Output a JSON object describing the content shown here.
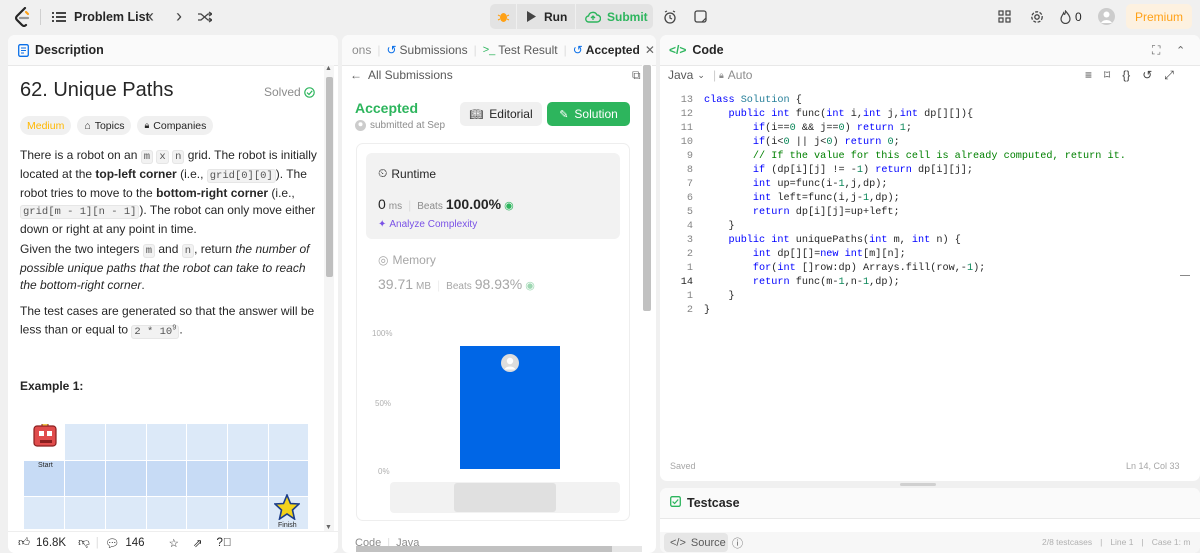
{
  "topbar": {
    "problem_list": "Problem List",
    "run": "Run",
    "submit": "Submit",
    "fire_count": "0",
    "premium": "Premium"
  },
  "desc": {
    "tab": "Description",
    "title": "62. Unique Paths",
    "solved": "Solved",
    "difficulty": "Medium",
    "topics": "Topics",
    "companies": "Companies",
    "p1": {
      "a": "There is a robot on an ",
      "m": "m",
      "x": "x",
      "n": "n",
      "b": " grid. The robot is initially located at the ",
      "tl": "top-left corner",
      "c": " (i.e., ",
      "g1": "grid[0][0]",
      "d": "). The robot tries to move to the ",
      "br": "bottom-right corner",
      "e": " (i.e., ",
      "g2": "grid[m - 1][n - 1]",
      "f": "). The robot can only move either down or right at any point in time."
    },
    "p2": {
      "a": "Given the two integers ",
      "m": "m",
      "and": " and ",
      "n": "n",
      ", return ": ", return ",
      "em": "the number of possible unique paths that the robot can take to reach the bottom-right corner",
      "dot": "."
    },
    "p3": {
      "a": "The test cases are generated so that the answer will be less than or equal to ",
      "code": "2 * 10",
      "sup": "9",
      "dot": "."
    },
    "example_title": "Example 1:",
    "start": "Start",
    "finish": "Finish",
    "likes": "16.8K",
    "comments": "146"
  },
  "sub": {
    "tabs": [
      "ons",
      "Submissions",
      "Test Result",
      "Accepted"
    ],
    "all": "All Submissions",
    "status": "Accepted",
    "submitted": "submitted at Sep",
    "editorial": "Editorial",
    "solution": "Solution",
    "runtime": "Runtime",
    "rt_val": "0",
    "rt_unit": "ms",
    "beats": "Beats",
    "rt_pct": "100.00%",
    "analyze": "Analyze Complexity",
    "memory": "Memory",
    "mem_val": "39.71",
    "mem_unit": "MB",
    "mem_pct": "98.93%",
    "y100": "100%",
    "y50": "50%",
    "y0": "0%",
    "code_label": "Code",
    "lang_label": "Java",
    "bar_fraction": 1.0
  },
  "code": {
    "tab": "Code",
    "lang": "Java",
    "mode": "Auto",
    "lines": [
      {
        "n": "13",
        "c": [
          [
            "kw",
            "class "
          ],
          [
            "ty",
            "Solution"
          ],
          [
            "tx",
            " {"
          ]
        ]
      },
      {
        "n": "12",
        "c": [
          [
            "tx",
            "    "
          ],
          [
            "kw",
            "public int "
          ],
          [
            "tx",
            "func("
          ],
          [
            "kw",
            "int "
          ],
          [
            "tx",
            "i,"
          ],
          [
            "kw",
            "int "
          ],
          [
            "tx",
            "j,"
          ],
          [
            "kw",
            "int "
          ],
          [
            "tx",
            "dp[][]){"
          ]
        ]
      },
      {
        "n": "11",
        "c": [
          [
            "tx",
            "        "
          ],
          [
            "kw",
            "if"
          ],
          [
            "tx",
            "(i=="
          ],
          [
            "nm",
            "0"
          ],
          [
            "tx",
            " && j=="
          ],
          [
            "nm",
            "0"
          ],
          [
            "tx",
            ") "
          ],
          [
            "kw",
            "return "
          ],
          [
            "nm",
            "1"
          ],
          [
            "tx",
            ";"
          ]
        ]
      },
      {
        "n": "10",
        "c": [
          [
            "tx",
            "        "
          ],
          [
            "kw",
            "if"
          ],
          [
            "tx",
            "(i<"
          ],
          [
            "nm",
            "0"
          ],
          [
            "tx",
            " || j<"
          ],
          [
            "nm",
            "0"
          ],
          [
            "tx",
            ") "
          ],
          [
            "kw",
            "return "
          ],
          [
            "nm",
            "0"
          ],
          [
            "tx",
            ";"
          ]
        ]
      },
      {
        "n": "9",
        "c": [
          [
            "tx",
            "        "
          ],
          [
            "cm",
            "// If the value for this cell is already computed, return it."
          ]
        ]
      },
      {
        "n": "8",
        "c": [
          [
            "tx",
            "        "
          ],
          [
            "kw",
            "if"
          ],
          [
            "tx",
            " (dp[i][j] != -"
          ],
          [
            "nm",
            "1"
          ],
          [
            "tx",
            ") "
          ],
          [
            "kw",
            "return "
          ],
          [
            "tx",
            "dp[i][j];"
          ]
        ]
      },
      {
        "n": "7",
        "c": [
          [
            "tx",
            "        "
          ],
          [
            "kw",
            "int "
          ],
          [
            "tx",
            "up=func(i-"
          ],
          [
            "nm",
            "1"
          ],
          [
            "tx",
            ",j,dp);"
          ]
        ]
      },
      {
        "n": "6",
        "c": [
          [
            "tx",
            "        "
          ],
          [
            "kw",
            "int "
          ],
          [
            "tx",
            "left=func(i,j-"
          ],
          [
            "nm",
            "1"
          ],
          [
            "tx",
            ",dp);"
          ]
        ]
      },
      {
        "n": "5",
        "c": [
          [
            "tx",
            "        "
          ],
          [
            "kw",
            "return "
          ],
          [
            "tx",
            "dp[i][j]=up+left;"
          ]
        ]
      },
      {
        "n": "4",
        "c": [
          [
            "tx",
            "    }"
          ]
        ]
      },
      {
        "n": "3",
        "c": [
          [
            "tx",
            "    "
          ],
          [
            "kw",
            "public int "
          ],
          [
            "tx",
            "uniquePaths("
          ],
          [
            "kw",
            "int "
          ],
          [
            "tx",
            "m, "
          ],
          [
            "kw",
            "int "
          ],
          [
            "tx",
            "n) {"
          ]
        ]
      },
      {
        "n": "2",
        "c": [
          [
            "tx",
            "        "
          ],
          [
            "kw",
            "int "
          ],
          [
            "tx",
            "dp[][]="
          ],
          [
            "kw",
            "new int"
          ],
          [
            "tx",
            "[m][n];"
          ]
        ]
      },
      {
        "n": "1",
        "c": [
          [
            "tx",
            "        "
          ],
          [
            "kw",
            "for"
          ],
          [
            "tx",
            "("
          ],
          [
            "kw",
            "int "
          ],
          [
            "tx",
            "[]row:dp) Arrays.fill(row,-"
          ],
          [
            "nm",
            "1"
          ],
          [
            "tx",
            ");"
          ]
        ]
      },
      {
        "n": "14",
        "c": [
          [
            "tx",
            "        "
          ],
          [
            "kw",
            "return "
          ],
          [
            "tx",
            "func(m-"
          ],
          [
            "nm",
            "1"
          ],
          [
            "tx",
            ",n-"
          ],
          [
            "nm",
            "1"
          ],
          [
            "tx",
            ",dp);"
          ]
        ]
      },
      {
        "n": "1",
        "c": [
          [
            "tx",
            "    }"
          ]
        ]
      },
      {
        "n": "2",
        "c": [
          [
            "tx",
            "}"
          ]
        ]
      }
    ],
    "saved": "Saved",
    "cursor": "Ln 14, Col 33"
  },
  "testcase": {
    "tab": "Testcase",
    "source": "Source",
    "count": "2/8 testcases",
    "line": "Line 1",
    "case": "Case 1: m"
  },
  "colors": {
    "accent": "#2db55d",
    "blue": "#0a6fe8",
    "orange": "#ffa116",
    "bar": "#0066e6"
  }
}
